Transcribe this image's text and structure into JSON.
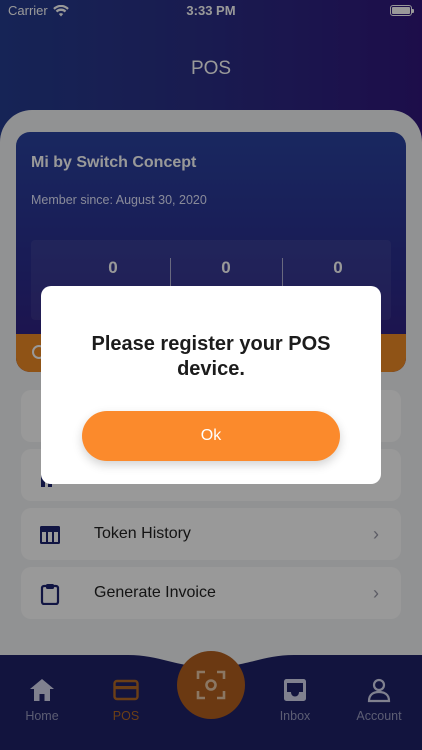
{
  "status_bar": {
    "carrier": "Carrier",
    "time": "3:33 PM"
  },
  "header": {
    "title": "POS"
  },
  "member_card": {
    "name": "Mi by Switch Concept",
    "member_since": "Member since: August 30, 2020",
    "stats": [
      "0",
      "0",
      "0"
    ]
  },
  "menu": {
    "items": [
      {
        "label": "Token History",
        "icon": "table-icon"
      },
      {
        "label": "Generate Invoice",
        "icon": "clipboard-icon"
      }
    ]
  },
  "bottom_nav": {
    "items": [
      {
        "label": "Home",
        "icon": "home-icon"
      },
      {
        "label": "POS",
        "icon": "card-icon",
        "active": true
      },
      {
        "label": "Inbox",
        "icon": "inbox-icon"
      },
      {
        "label": "Account",
        "icon": "account-icon"
      }
    ],
    "center": {
      "icon": "scan-icon"
    }
  },
  "dialog": {
    "message": "Please register your POS device.",
    "ok_label": "Ok"
  },
  "colors": {
    "accent": "#fb8a2c",
    "header_start": "#253c8f",
    "header_end": "#31177c",
    "nav_background": "#1e2268"
  }
}
